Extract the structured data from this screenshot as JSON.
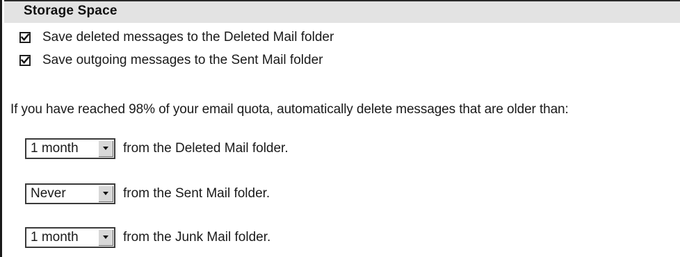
{
  "section": {
    "title": "Storage Space"
  },
  "options": [
    {
      "label": "Save deleted messages to the Deleted Mail folder",
      "checked": true
    },
    {
      "label": "Save outgoing messages to the Sent Mail folder",
      "checked": true
    }
  ],
  "quota_text": "If you have reached 98% of your email quota, automatically delete messages that are older than:",
  "cleanup_rules": [
    {
      "selected": "1 month",
      "suffix": "from the Deleted Mail folder."
    },
    {
      "selected": "Never",
      "suffix": "from the Sent Mail folder."
    },
    {
      "selected": "1 month",
      "suffix": "from the Junk Mail folder."
    }
  ],
  "icons": {
    "checkbox_check": "check-icon",
    "dropdown_arrow": "chevron-down-icon"
  },
  "colors": {
    "header_background": "#e3e3e3",
    "text": "#1a1a1a",
    "border": "#3a3a3a"
  }
}
